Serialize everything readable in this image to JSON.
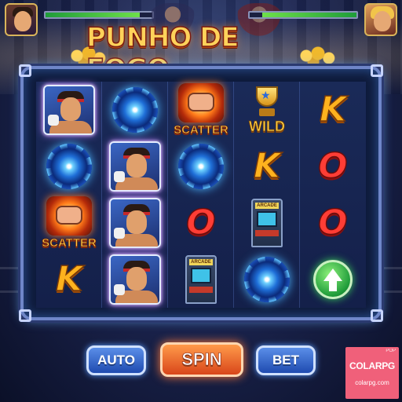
{
  "title": "PUNHO DE FOGO",
  "hud": {
    "player_hp": 0.88,
    "opponent_hp": 0.88
  },
  "reels": [
    [
      "fighter",
      "vortex",
      "scatter",
      "letter-k"
    ],
    [
      "vortex",
      "fighter",
      "fighter",
      "fighter"
    ],
    [
      "scatter",
      "vortex",
      "letter-o",
      "arcade"
    ],
    [
      "wild",
      "letter-k",
      "arcade",
      "vortex"
    ],
    [
      "letter-k",
      "letter-o",
      "letter-o",
      "arrow-up"
    ]
  ],
  "symbols": {
    "scatter_label": "SCATTER",
    "wild_label": "WILD",
    "letter_k": "K",
    "letter_o": "O",
    "arcade_label": "ARCADE"
  },
  "controls": {
    "auto_label": "AUTO",
    "spin_label": "SPIN",
    "bet_label": "BET"
  },
  "watermark": {
    "sup": "POP",
    "name": "COLARPG",
    "url": "colarpg.com"
  },
  "colors": {
    "accent_orange": "#ff7a2a",
    "accent_blue": "#4ab2ff",
    "frame": "#6f86c8"
  }
}
